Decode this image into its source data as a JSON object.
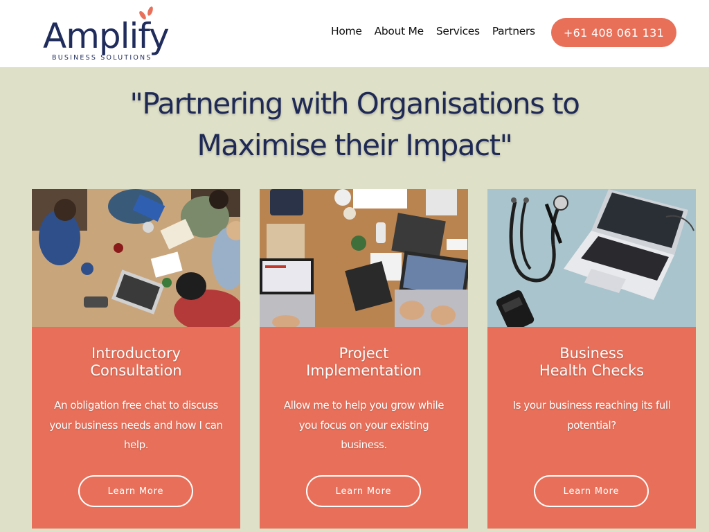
{
  "logo": {
    "name": "Amplify",
    "tagline": "BUSINESS  SOLUTIONS"
  },
  "nav": {
    "items": [
      "Home",
      "About Me",
      "Services",
      "Partners"
    ],
    "phone": "+61 408 061 131"
  },
  "hero": {
    "line1": "\"Partnering with Organisations to",
    "line2": "Maximise their Impact\""
  },
  "cards": [
    {
      "title_line1": "Introductory",
      "title_line2": "Consultation",
      "description": "An obligation free chat to discuss your business needs and how I can help.",
      "button": "Learn More",
      "photo": "team-meeting-photo"
    },
    {
      "title_line1": "Project",
      "title_line2": "Implementation",
      "description": "Allow me to help you grow while you focus on your existing business.",
      "button": "Learn More",
      "photo": "laptops-desk-photo"
    },
    {
      "title_line1": "Business",
      "title_line2": "Health Checks",
      "description": "Is your business reaching its full potential?",
      "button": "Learn More",
      "photo": "stethoscope-laptop-photo"
    }
  ],
  "colors": {
    "accent": "#e87059",
    "navy": "#1e2a55",
    "background": "#dfe0c8",
    "header": "#ffffff"
  }
}
